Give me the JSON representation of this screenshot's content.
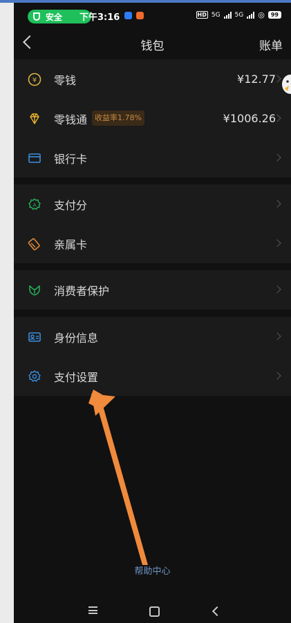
{
  "statusbar": {
    "safe_label": "安全",
    "time": "下午3:16",
    "network_hd": "HD",
    "network_5g_1": "5G",
    "network_5g_2": "5G",
    "battery": "99"
  },
  "navbar": {
    "title": "钱包",
    "bill_link": "账单"
  },
  "sections": [
    {
      "items": [
        {
          "label": "零钱",
          "value": "¥12.77",
          "icon": "yuan-coin-icon",
          "color": "#d9b341"
        },
        {
          "label": "零钱通",
          "badge": "收益率1.78%",
          "value": "¥1006.26",
          "icon": "diamond-icon",
          "color": "#e7b32c"
        },
        {
          "label": "银行卡",
          "value": "",
          "icon": "bank-card-icon",
          "color": "#3a8fe0"
        }
      ]
    },
    {
      "items": [
        {
          "label": "支付分",
          "value": "",
          "icon": "credit-score-icon",
          "color": "#27b35a"
        },
        {
          "label": "亲属卡",
          "value": "",
          "icon": "family-card-icon",
          "color": "#e08a3a"
        }
      ]
    },
    {
      "items": [
        {
          "label": "消费者保护",
          "value": "",
          "icon": "consumer-protection-icon",
          "color": "#27b35a"
        }
      ]
    },
    {
      "items": [
        {
          "label": "身份信息",
          "value": "",
          "icon": "id-card-icon",
          "color": "#3a8fe0"
        },
        {
          "label": "支付设置",
          "value": "",
          "icon": "settings-gear-icon",
          "color": "#3a8fe0"
        }
      ]
    }
  ],
  "footer": {
    "help_center": "帮助中心"
  },
  "colors": {
    "annotation_arrow": "#f08a3c",
    "background": "#111111",
    "section": "#1b1b1b"
  }
}
